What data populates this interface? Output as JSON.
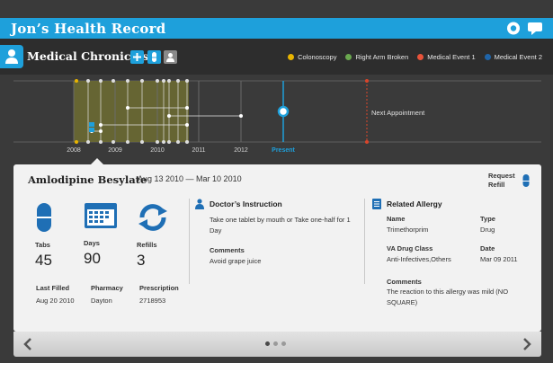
{
  "window": {
    "title": "Jon’s Health Record",
    "icons": [
      "record-icon",
      "message-icon"
    ]
  },
  "header": {
    "section_title": "Medical Chronicles",
    "buttons": [
      "add-icon",
      "medication-icon",
      "person-icon"
    ]
  },
  "legend": [
    {
      "label": "Colonoscopy",
      "color": "#e8b400"
    },
    {
      "label": "Right Arm Broken",
      "color": "#6aa84f"
    },
    {
      "label": "Medical Event 1",
      "color": "#e8533a"
    },
    {
      "label": "Medical Event 2",
      "color": "#1f64a8"
    }
  ],
  "timeline": {
    "years": [
      "2008",
      "2009",
      "2010",
      "2011",
      "2012"
    ],
    "present_label": "Present",
    "next_label": "Next Appointment",
    "colors": {
      "accent": "#1ea0db",
      "band": "#6b6a33",
      "next": "#d9452b"
    }
  },
  "drug": {
    "name": "Amlodipine Besylate",
    "dates": "Aug 13 2010 — Mar 10 2010",
    "refill_label": "Request Refill",
    "stats": [
      {
        "label": "Tabs",
        "value": "45",
        "icon": "pill-icon"
      },
      {
        "label": "Days",
        "value": "90",
        "icon": "calendar-icon"
      },
      {
        "label": "Refills",
        "value": "3",
        "icon": "refresh-icon"
      }
    ],
    "details": [
      {
        "label": "Last Filled",
        "value": "Aug 20 2010"
      },
      {
        "label": "Pharmacy",
        "value": "Dayton"
      },
      {
        "label": "Prescription",
        "value": "2718953"
      }
    ]
  },
  "instruction": {
    "title": "Doctor’s Instruction",
    "text": "Take one tablet by mouth or Take one-half for 1 Day",
    "comments_label": "Comments",
    "comments": "Avoid grape juice"
  },
  "allergy": {
    "title": "Related Allergy",
    "name_label": "Name",
    "name": "Trimethorprim",
    "type_label": "Type",
    "type": "Drug",
    "class_label": "VA Drug Class",
    "class": "Anti-Infectives,Others",
    "date_label": "Date",
    "date": "Mar 09 2011",
    "comments_label": "Comments",
    "comments": "The reaction to this allergy was mild (NO SQUARE)"
  },
  "pagination": {
    "pages": 3,
    "current": 1
  }
}
